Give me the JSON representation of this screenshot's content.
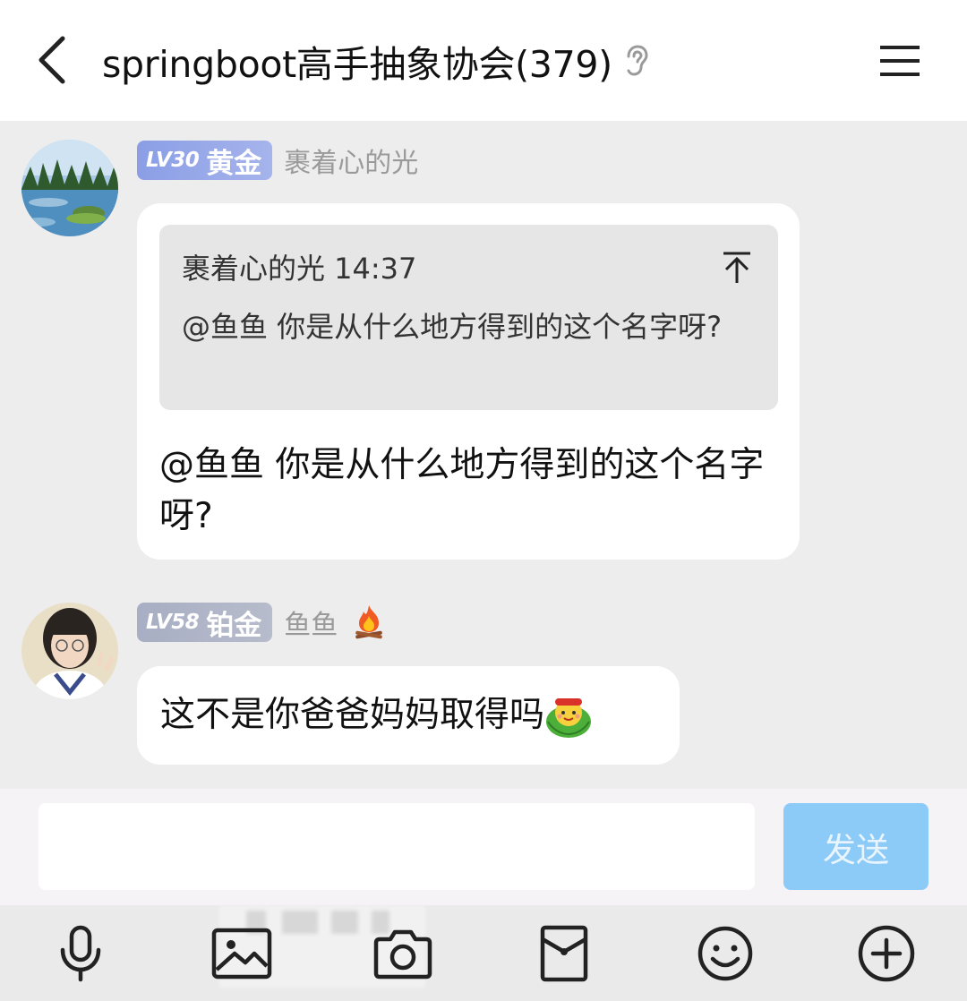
{
  "header": {
    "back_icon": "chevron-left-icon",
    "title": "springboot高手抽象协会(379)",
    "ear_icon": "ear-icon",
    "menu_icon": "hamburger-menu-icon"
  },
  "messages": [
    {
      "level": "LV30",
      "rank": "黄金",
      "nickname": "裹着心的光",
      "quote": {
        "header": "裹着心的光 14:37",
        "text": "@鱼鱼 你是从什么地方得到的这个名字呀?",
        "icon": "arrow-to-top-icon"
      },
      "text": "@鱼鱼 你是从什么地方得到的这个名字呀?"
    },
    {
      "level": "LV58",
      "rank": "铂金",
      "nickname": "鱼鱼",
      "nickname_icon": "fire-icon",
      "text": "这不是你爸爸妈妈取得吗",
      "emoji": "swaddled-baby-emoji"
    }
  ],
  "input": {
    "value": "",
    "send_label": "发送"
  },
  "toolbar": [
    {
      "name": "microphone-icon"
    },
    {
      "name": "image-icon"
    },
    {
      "name": "camera-icon"
    },
    {
      "name": "red-packet-icon"
    },
    {
      "name": "smiley-icon"
    },
    {
      "name": "plus-circle-icon"
    }
  ],
  "colors": {
    "background": "#ededed",
    "send_button": "#8ccaf7",
    "gold_badge": "#8b9ee6",
    "platinum_badge": "#a8aec3"
  }
}
